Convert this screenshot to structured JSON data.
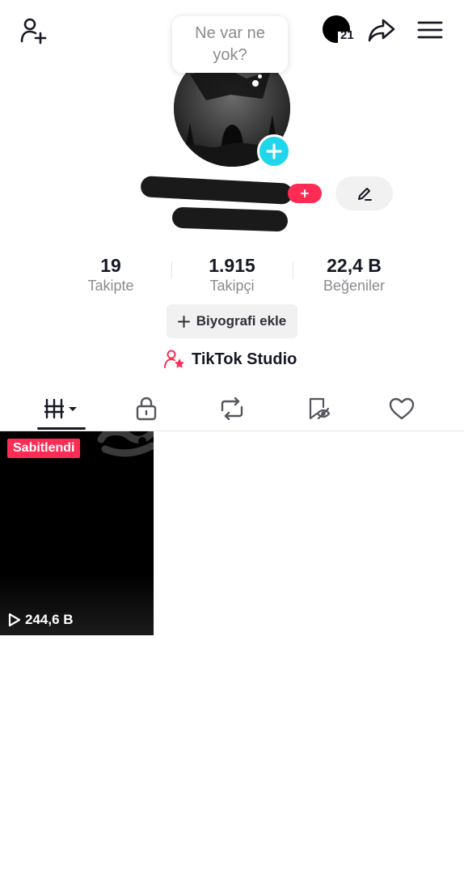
{
  "header": {
    "add_friend_icon": "person-plus-icon",
    "notifications_count": "21",
    "share_icon": "share-arrow-icon",
    "menu_icon": "hamburger-menu-icon"
  },
  "bubble": {
    "line1": "Ne var ne",
    "line2": "yok?"
  },
  "stats": [
    {
      "value": "19",
      "label": "Takipte"
    },
    {
      "value": "1.915",
      "label": "Takipçi"
    },
    {
      "value": "22,4 B",
      "label": "Beğeniler"
    }
  ],
  "actions": {
    "bio_label": "Biyografi ekle",
    "studio_label": "TikTok Studio"
  },
  "tabs": [
    "videos-grid",
    "private",
    "reposts",
    "favorites",
    "liked"
  ],
  "videos": [
    {
      "badge": "Sabitlendi",
      "views": "244,6 B"
    }
  ],
  "colors": {
    "accent": "#fe2c55",
    "cyan": "#20d5ec",
    "text": "#161823",
    "muted": "#8a8b91"
  }
}
